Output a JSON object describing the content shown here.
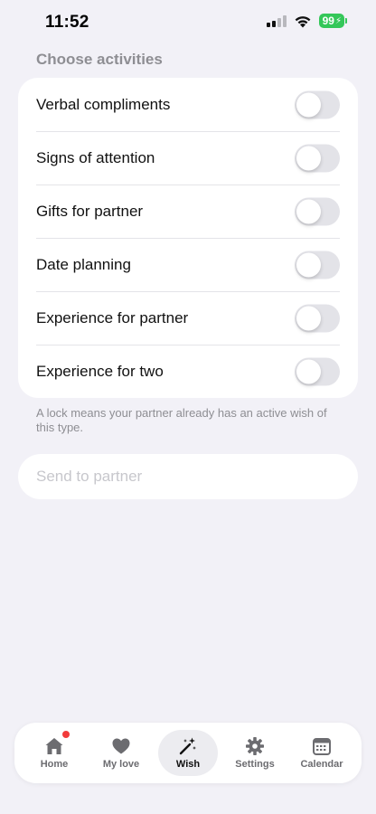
{
  "status_bar": {
    "time": "11:52",
    "battery": "99"
  },
  "section_title": "Choose activities",
  "activities": [
    {
      "label": "Verbal compliments",
      "enabled": false
    },
    {
      "label": "Signs of attention",
      "enabled": false
    },
    {
      "label": "Gifts for partner",
      "enabled": false
    },
    {
      "label": "Date planning",
      "enabled": false
    },
    {
      "label": "Experience for partner",
      "enabled": false
    },
    {
      "label": "Experience for two",
      "enabled": false
    }
  ],
  "footnote": "A lock means your partner already has an active wish of this type.",
  "send_button": {
    "label": "Send to partner"
  },
  "tabs": [
    {
      "label": "Home",
      "icon": "house-icon",
      "has_badge": true
    },
    {
      "label": "My love",
      "icon": "heart-icon",
      "has_badge": false
    },
    {
      "label": "Wish",
      "icon": "magic-wand-icon",
      "active": true
    },
    {
      "label": "Settings",
      "icon": "gear-icon"
    },
    {
      "label": "Calendar",
      "icon": "calendar-icon"
    }
  ],
  "colors": {
    "background": "#f2f1f7",
    "card": "#ffffff",
    "secondary_text": "#8e8e93",
    "toggle_off": "#e3e3e8",
    "badge": "#f23b3b",
    "battery": "#34c759"
  }
}
